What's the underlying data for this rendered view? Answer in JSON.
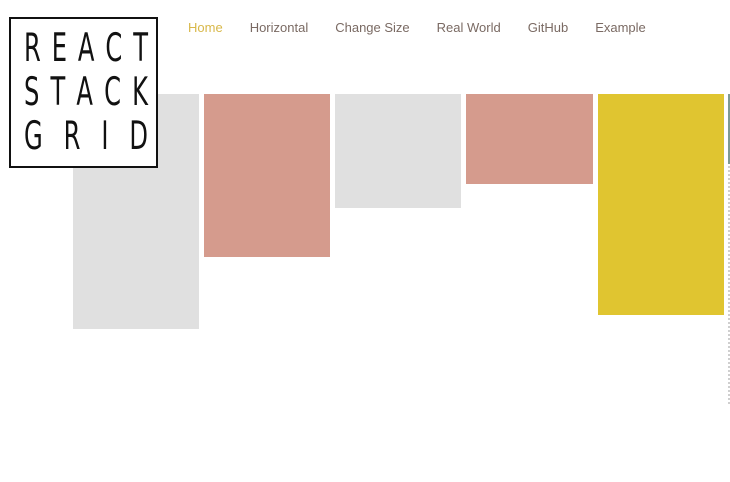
{
  "logo": {
    "lines": [
      [
        "R",
        "E",
        "A",
        "C",
        "T"
      ],
      [
        "S",
        "T",
        "A",
        "C",
        "K"
      ],
      [
        "G",
        "R",
        "I",
        "D"
      ]
    ]
  },
  "nav": {
    "items": [
      {
        "label": "Home",
        "active": true
      },
      {
        "label": "Horizontal",
        "active": false
      },
      {
        "label": "Change Size",
        "active": false
      },
      {
        "label": "Real World",
        "active": false
      },
      {
        "label": "GitHub",
        "active": false
      },
      {
        "label": "Example",
        "active": false
      }
    ]
  },
  "colors": {
    "gray": "#e0e0e0",
    "pink": "#d59b8d",
    "yellow": "#e0c530",
    "active_nav": "#d8b84a",
    "nav_text": "#7a6a63",
    "logo_ink": "#111111"
  }
}
